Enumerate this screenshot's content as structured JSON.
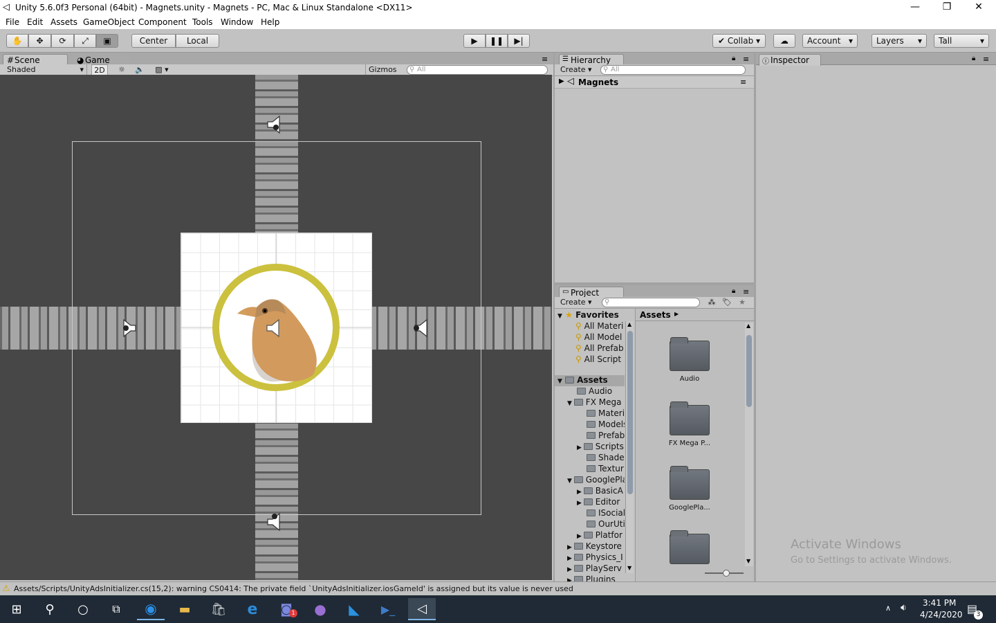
{
  "window": {
    "title": "Unity 5.6.0f3 Personal (64bit) - Magnets.unity - Magnets - PC, Mac & Linux Standalone <DX11>",
    "minimize": "—",
    "restore": "❐",
    "close": "✕"
  },
  "menu": [
    "File",
    "Edit",
    "Assets",
    "GameObject",
    "Component",
    "Tools",
    "Window",
    "Help"
  ],
  "toolbar": {
    "pivot": "Center",
    "space": "Local",
    "collab": "Collab",
    "account": "Account",
    "layers": "Layers",
    "layout": "Tall"
  },
  "scene": {
    "tab_scene": "Scene",
    "tab_game": "Game",
    "shading": "Shaded",
    "mode_2d": "2D",
    "gizmos": "Gizmos",
    "search_placeholder": "All"
  },
  "hierarchy": {
    "tab": "Hierarchy",
    "create": "Create",
    "search_placeholder": "All",
    "root": "Magnets"
  },
  "inspector": {
    "tab": "Inspector"
  },
  "project": {
    "tab": "Project",
    "create": "Create",
    "favorites_label": "Favorites",
    "favorites": [
      "All Materi",
      "All Model",
      "All Prefab",
      "All Script"
    ],
    "assets_label": "Assets",
    "tree": [
      "Audio",
      "FX Mega",
      "Materia",
      "Models",
      "Prefab",
      "Scripts",
      "Shader",
      "Textur",
      "GooglePla",
      "BasicA",
      "Editor",
      "ISocial",
      "OurUtil",
      "Platfor",
      "Keystore",
      "Physics_I",
      "PlayServ",
      "Plugins"
    ],
    "breadcrumb": "Assets",
    "grid_items": [
      "Audio",
      "FX Mega P...",
      "GooglePla...",
      ""
    ]
  },
  "watermark": {
    "line1": "Activate Windows",
    "line2": "Go to Settings to activate Windows."
  },
  "status": {
    "message": "Assets/Scripts/UnityAdsInitializer.cs(15,2): warning CS0414: The private field `UnityAdsInitializer.iosGameId' is assigned but its value is never used"
  },
  "taskbar": {
    "time": "3:41 PM",
    "date": "4/24/2020",
    "discord_badge": "1",
    "notif_badge": "3"
  }
}
